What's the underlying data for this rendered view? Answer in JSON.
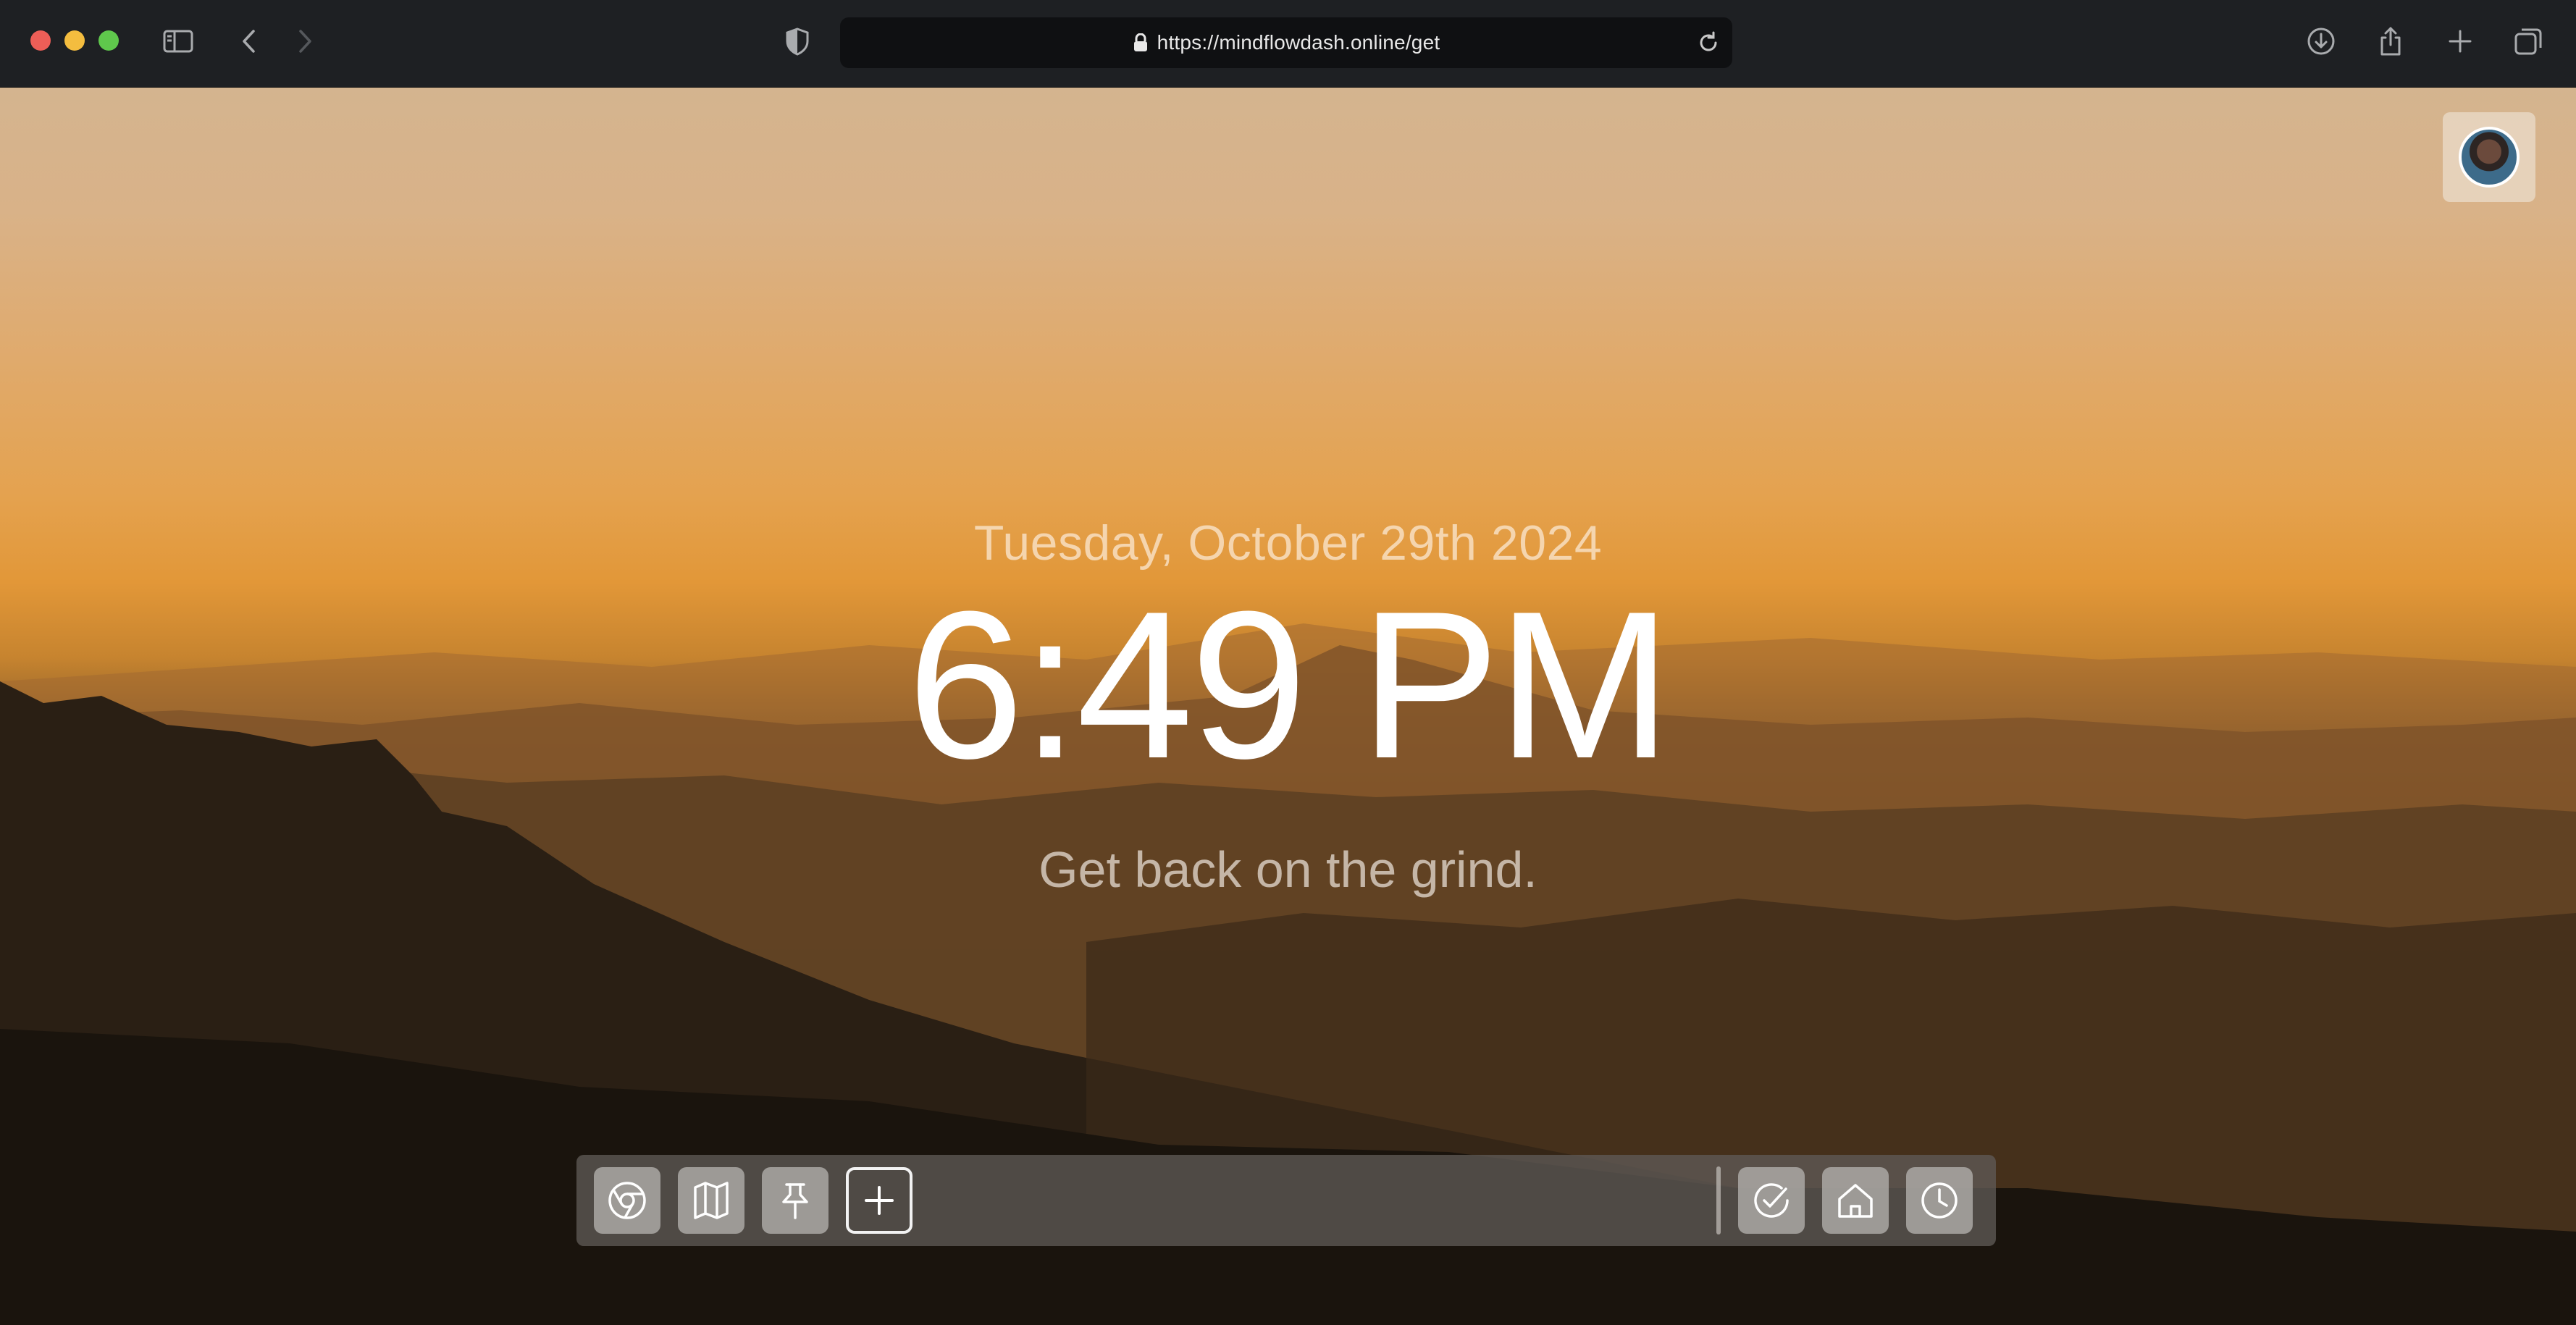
{
  "browser": {
    "url": "https://mindflowdash.online/get"
  },
  "dashboard": {
    "date": "Tuesday, October 29th 2024",
    "time": "6:49 PM",
    "tagline": "Get back on the grind."
  },
  "dock": {
    "left_items": [
      "chrome-icon",
      "map-icon",
      "pin-icon",
      "add-icon"
    ],
    "right_items": [
      "check-icon",
      "home-icon",
      "clock-icon"
    ]
  },
  "colors": {
    "toolbar_bg": "#1e2023",
    "sky_top": "#d4b48f",
    "sky_horizon": "#e29738",
    "mountain_dark": "#17120c"
  }
}
